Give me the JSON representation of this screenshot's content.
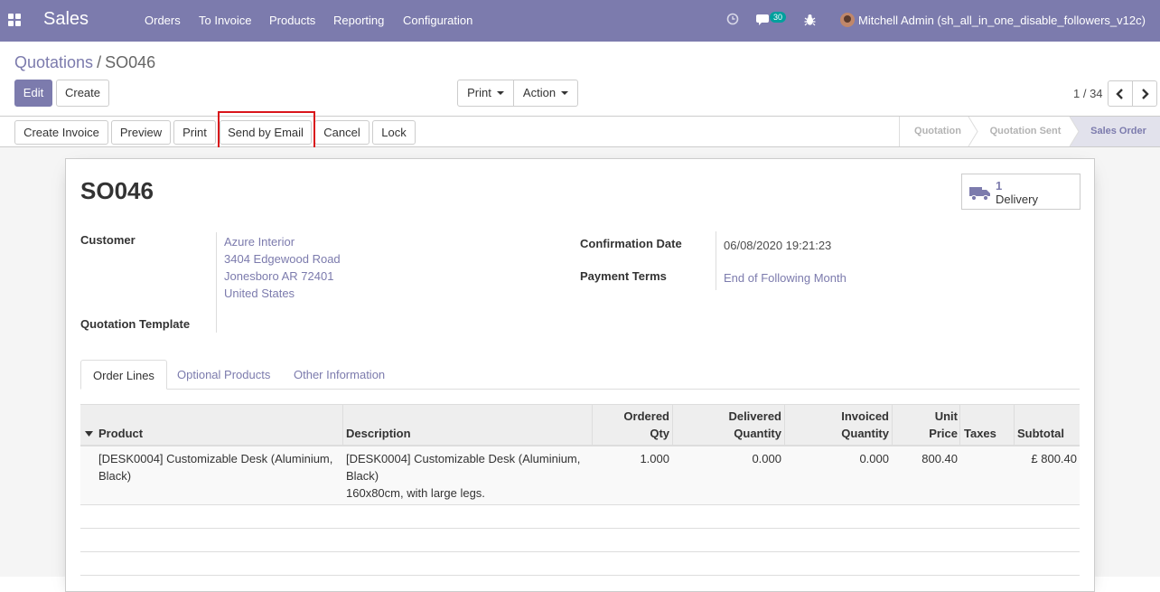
{
  "navbar": {
    "brand": "Sales",
    "menu": [
      "Orders",
      "To Invoice",
      "Products",
      "Reporting",
      "Configuration"
    ],
    "message_count": "30",
    "user": "Mitchell Admin (sh_all_in_one_disable_followers_v12c)"
  },
  "breadcrumb": {
    "parent": "Quotations",
    "separator": "/",
    "current": "SO046"
  },
  "buttons": {
    "edit": "Edit",
    "create": "Create",
    "print": "Print",
    "action": "Action"
  },
  "pager": {
    "value": "1 / 34"
  },
  "statusbar": {
    "actions": [
      "Create Invoice",
      "Preview",
      "Print",
      "Send by Email",
      "Cancel",
      "Lock"
    ],
    "stages": [
      "Quotation",
      "Quotation Sent",
      "Sales Order"
    ],
    "active_stage": "Sales Order"
  },
  "record": {
    "name": "SO046",
    "delivery_count": "1",
    "delivery_label": "Delivery",
    "customer_label": "Customer",
    "customer_lines": [
      "Azure Interior",
      "3404 Edgewood Road",
      "Jonesboro AR 72401",
      "United States"
    ],
    "template_label": "Quotation Template",
    "confirmation_label": "Confirmation Date",
    "confirmation_value": "06/08/2020 19:21:23",
    "payment_terms_label": "Payment Terms",
    "payment_terms_value": "End of Following Month"
  },
  "tabs": [
    "Order Lines",
    "Optional Products",
    "Other Information"
  ],
  "table": {
    "headers": {
      "product": "Product",
      "description": "Description",
      "ordered_1": "Ordered",
      "ordered_2": "Qty",
      "delivered_1": "Delivered",
      "delivered_2": "Quantity",
      "invoiced_1": "Invoiced",
      "invoiced_2": "Quantity",
      "price_1": "Unit",
      "price_2": "Price",
      "taxes": "Taxes",
      "subtotal": "Subtotal"
    },
    "rows": [
      {
        "product_1": "[DESK0004] Customizable Desk (Aluminium,",
        "product_2": "Black)",
        "desc_1": "[DESK0004] Customizable Desk (Aluminium,",
        "desc_2": "Black)",
        "desc_3": "160x80cm, with large legs.",
        "ordered": "1.000",
        "delivered": "0.000",
        "invoiced": "0.000",
        "price": "800.40",
        "taxes": "",
        "subtotal": "£ 800.40"
      }
    ]
  },
  "colors": {
    "brand": "#7c7bad",
    "highlight": "#d9151b",
    "badge": "#00a09d"
  }
}
